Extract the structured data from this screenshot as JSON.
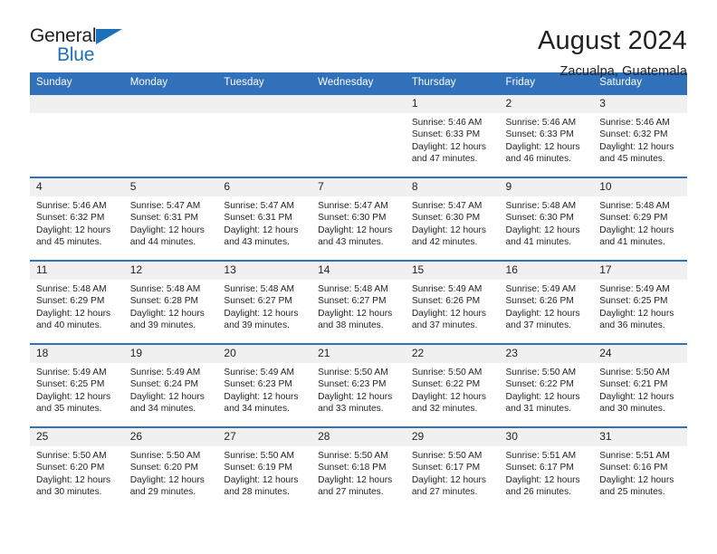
{
  "brand": {
    "word_one": "General",
    "word_two": "Blue",
    "flag_icon": "triangle-flag-icon",
    "accent_color": "#1b72b8"
  },
  "header": {
    "title": "August 2024",
    "subtitle": "Zacualpa, Guatemala"
  },
  "calendar": {
    "header_color": "#3071b9",
    "daynum_band_color": "#f0f0f0",
    "weekdays": [
      "Sunday",
      "Monday",
      "Tuesday",
      "Wednesday",
      "Thursday",
      "Friday",
      "Saturday"
    ],
    "weeks": [
      [
        {
          "day": "",
          "sunrise": "",
          "sunset": "",
          "daylight_1": "",
          "daylight_2": ""
        },
        {
          "day": "",
          "sunrise": "",
          "sunset": "",
          "daylight_1": "",
          "daylight_2": ""
        },
        {
          "day": "",
          "sunrise": "",
          "sunset": "",
          "daylight_1": "",
          "daylight_2": ""
        },
        {
          "day": "",
          "sunrise": "",
          "sunset": "",
          "daylight_1": "",
          "daylight_2": ""
        },
        {
          "day": "1",
          "sunrise": "Sunrise: 5:46 AM",
          "sunset": "Sunset: 6:33 PM",
          "daylight_1": "Daylight: 12 hours",
          "daylight_2": "and 47 minutes."
        },
        {
          "day": "2",
          "sunrise": "Sunrise: 5:46 AM",
          "sunset": "Sunset: 6:33 PM",
          "daylight_1": "Daylight: 12 hours",
          "daylight_2": "and 46 minutes."
        },
        {
          "day": "3",
          "sunrise": "Sunrise: 5:46 AM",
          "sunset": "Sunset: 6:32 PM",
          "daylight_1": "Daylight: 12 hours",
          "daylight_2": "and 45 minutes."
        }
      ],
      [
        {
          "day": "4",
          "sunrise": "Sunrise: 5:46 AM",
          "sunset": "Sunset: 6:32 PM",
          "daylight_1": "Daylight: 12 hours",
          "daylight_2": "and 45 minutes."
        },
        {
          "day": "5",
          "sunrise": "Sunrise: 5:47 AM",
          "sunset": "Sunset: 6:31 PM",
          "daylight_1": "Daylight: 12 hours",
          "daylight_2": "and 44 minutes."
        },
        {
          "day": "6",
          "sunrise": "Sunrise: 5:47 AM",
          "sunset": "Sunset: 6:31 PM",
          "daylight_1": "Daylight: 12 hours",
          "daylight_2": "and 43 minutes."
        },
        {
          "day": "7",
          "sunrise": "Sunrise: 5:47 AM",
          "sunset": "Sunset: 6:30 PM",
          "daylight_1": "Daylight: 12 hours",
          "daylight_2": "and 43 minutes."
        },
        {
          "day": "8",
          "sunrise": "Sunrise: 5:47 AM",
          "sunset": "Sunset: 6:30 PM",
          "daylight_1": "Daylight: 12 hours",
          "daylight_2": "and 42 minutes."
        },
        {
          "day": "9",
          "sunrise": "Sunrise: 5:48 AM",
          "sunset": "Sunset: 6:30 PM",
          "daylight_1": "Daylight: 12 hours",
          "daylight_2": "and 41 minutes."
        },
        {
          "day": "10",
          "sunrise": "Sunrise: 5:48 AM",
          "sunset": "Sunset: 6:29 PM",
          "daylight_1": "Daylight: 12 hours",
          "daylight_2": "and 41 minutes."
        }
      ],
      [
        {
          "day": "11",
          "sunrise": "Sunrise: 5:48 AM",
          "sunset": "Sunset: 6:29 PM",
          "daylight_1": "Daylight: 12 hours",
          "daylight_2": "and 40 minutes."
        },
        {
          "day": "12",
          "sunrise": "Sunrise: 5:48 AM",
          "sunset": "Sunset: 6:28 PM",
          "daylight_1": "Daylight: 12 hours",
          "daylight_2": "and 39 minutes."
        },
        {
          "day": "13",
          "sunrise": "Sunrise: 5:48 AM",
          "sunset": "Sunset: 6:27 PM",
          "daylight_1": "Daylight: 12 hours",
          "daylight_2": "and 39 minutes."
        },
        {
          "day": "14",
          "sunrise": "Sunrise: 5:48 AM",
          "sunset": "Sunset: 6:27 PM",
          "daylight_1": "Daylight: 12 hours",
          "daylight_2": "and 38 minutes."
        },
        {
          "day": "15",
          "sunrise": "Sunrise: 5:49 AM",
          "sunset": "Sunset: 6:26 PM",
          "daylight_1": "Daylight: 12 hours",
          "daylight_2": "and 37 minutes."
        },
        {
          "day": "16",
          "sunrise": "Sunrise: 5:49 AM",
          "sunset": "Sunset: 6:26 PM",
          "daylight_1": "Daylight: 12 hours",
          "daylight_2": "and 37 minutes."
        },
        {
          "day": "17",
          "sunrise": "Sunrise: 5:49 AM",
          "sunset": "Sunset: 6:25 PM",
          "daylight_1": "Daylight: 12 hours",
          "daylight_2": "and 36 minutes."
        }
      ],
      [
        {
          "day": "18",
          "sunrise": "Sunrise: 5:49 AM",
          "sunset": "Sunset: 6:25 PM",
          "daylight_1": "Daylight: 12 hours",
          "daylight_2": "and 35 minutes."
        },
        {
          "day": "19",
          "sunrise": "Sunrise: 5:49 AM",
          "sunset": "Sunset: 6:24 PM",
          "daylight_1": "Daylight: 12 hours",
          "daylight_2": "and 34 minutes."
        },
        {
          "day": "20",
          "sunrise": "Sunrise: 5:49 AM",
          "sunset": "Sunset: 6:23 PM",
          "daylight_1": "Daylight: 12 hours",
          "daylight_2": "and 34 minutes."
        },
        {
          "day": "21",
          "sunrise": "Sunrise: 5:50 AM",
          "sunset": "Sunset: 6:23 PM",
          "daylight_1": "Daylight: 12 hours",
          "daylight_2": "and 33 minutes."
        },
        {
          "day": "22",
          "sunrise": "Sunrise: 5:50 AM",
          "sunset": "Sunset: 6:22 PM",
          "daylight_1": "Daylight: 12 hours",
          "daylight_2": "and 32 minutes."
        },
        {
          "day": "23",
          "sunrise": "Sunrise: 5:50 AM",
          "sunset": "Sunset: 6:22 PM",
          "daylight_1": "Daylight: 12 hours",
          "daylight_2": "and 31 minutes."
        },
        {
          "day": "24",
          "sunrise": "Sunrise: 5:50 AM",
          "sunset": "Sunset: 6:21 PM",
          "daylight_1": "Daylight: 12 hours",
          "daylight_2": "and 30 minutes."
        }
      ],
      [
        {
          "day": "25",
          "sunrise": "Sunrise: 5:50 AM",
          "sunset": "Sunset: 6:20 PM",
          "daylight_1": "Daylight: 12 hours",
          "daylight_2": "and 30 minutes."
        },
        {
          "day": "26",
          "sunrise": "Sunrise: 5:50 AM",
          "sunset": "Sunset: 6:20 PM",
          "daylight_1": "Daylight: 12 hours",
          "daylight_2": "and 29 minutes."
        },
        {
          "day": "27",
          "sunrise": "Sunrise: 5:50 AM",
          "sunset": "Sunset: 6:19 PM",
          "daylight_1": "Daylight: 12 hours",
          "daylight_2": "and 28 minutes."
        },
        {
          "day": "28",
          "sunrise": "Sunrise: 5:50 AM",
          "sunset": "Sunset: 6:18 PM",
          "daylight_1": "Daylight: 12 hours",
          "daylight_2": "and 27 minutes."
        },
        {
          "day": "29",
          "sunrise": "Sunrise: 5:50 AM",
          "sunset": "Sunset: 6:17 PM",
          "daylight_1": "Daylight: 12 hours",
          "daylight_2": "and 27 minutes."
        },
        {
          "day": "30",
          "sunrise": "Sunrise: 5:51 AM",
          "sunset": "Sunset: 6:17 PM",
          "daylight_1": "Daylight: 12 hours",
          "daylight_2": "and 26 minutes."
        },
        {
          "day": "31",
          "sunrise": "Sunrise: 5:51 AM",
          "sunset": "Sunset: 6:16 PM",
          "daylight_1": "Daylight: 12 hours",
          "daylight_2": "and 25 minutes."
        }
      ]
    ]
  }
}
